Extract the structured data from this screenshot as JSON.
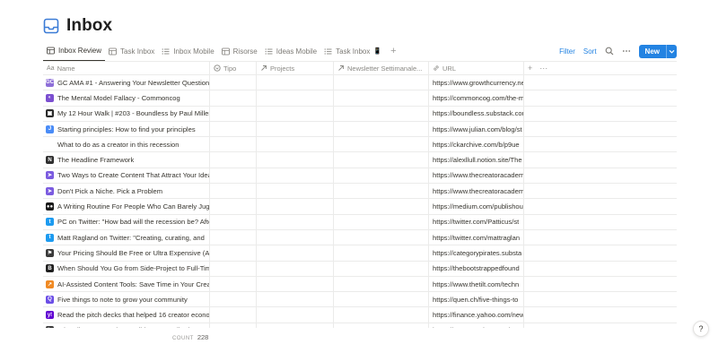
{
  "page": {
    "title": "Inbox",
    "icon": "inbox-icon"
  },
  "views": [
    {
      "label": "Inbox Review",
      "icon": "table-icon",
      "active": true
    },
    {
      "label": "Task Inbox",
      "icon": "table-icon"
    },
    {
      "label": "Inbox Mobile",
      "icon": "list-icon"
    },
    {
      "label": "Risorse",
      "icon": "table-icon"
    },
    {
      "label": "Ideas Mobile",
      "icon": "list-icon"
    },
    {
      "label": "Task Inbox",
      "icon": "list-icon",
      "suffix": "📱"
    }
  ],
  "toolbar": {
    "filter": "Filter",
    "sort": "Sort",
    "new": "New"
  },
  "columns": {
    "name": "Name",
    "tipo": "Tipo",
    "projects": "Projects",
    "newsletter": "Newsletter Settimanale...",
    "url": "URL"
  },
  "rows": [
    {
      "name": "GC AMA #1 - Answering Your Newsletter Questions",
      "url": "https://www.growthcurrency.net",
      "icon": "gc-icon",
      "color": "#8e6fd8",
      "glyph": "GC"
    },
    {
      "name": "The Mental Model Fallacy - Commoncog",
      "url": "https://commoncog.com/the-mental",
      "icon": "commoncog-icon",
      "color": "#7b4fd0",
      "glyph": "◐"
    },
    {
      "name": "My 12 Hour Walk | #203 - Boundless by Paul Millerd",
      "url": "https://boundless.substack.com",
      "icon": "boundless-icon",
      "color": "#2b2b2b",
      "glyph": "▣"
    },
    {
      "name": "Starting principles: How to find your principles",
      "url": "https://www.julian.com/blog/st",
      "icon": "julian-icon",
      "color": "#4a8cf7",
      "glyph": "J"
    },
    {
      "name": "What to do as a creator in this recession",
      "url": "https://ckarchive.com/b/p9ue",
      "icon": "",
      "color": "",
      "glyph": ""
    },
    {
      "name": "The Headline Framework",
      "url": "https://alexllull.notion.site/The",
      "icon": "notion-icon",
      "color": "#2f2f2f",
      "glyph": "N"
    },
    {
      "name": "Two Ways to Create Content That Attract Your Ideal",
      "url": "https://www.thecreatoracademy",
      "icon": "arrow-icon",
      "color": "#7b5be0",
      "glyph": "➤"
    },
    {
      "name": "Don't Pick a Niche. Pick a Problem",
      "url": "https://www.thecreatoracademy",
      "icon": "arrow-icon",
      "color": "#7b5be0",
      "glyph": "➤"
    },
    {
      "name": "A Writing Routine For People Who Can Barely Juggle",
      "url": "https://medium.com/publishous",
      "icon": "medium-icon",
      "color": "#1a1a1a",
      "glyph": "●●"
    },
    {
      "name": "PC on Twitter: \"How bad will the recession be? After",
      "url": "https://twitter.com/Patticus/st",
      "icon": "twitter-icon",
      "color": "#1d9bf0",
      "glyph": "t"
    },
    {
      "name": "Matt Ragland on Twitter: \"Creating, curating, and",
      "url": "https://twitter.com/mattraglan",
      "icon": "twitter-icon",
      "color": "#1d9bf0",
      "glyph": "t"
    },
    {
      "name": "Your Pricing Should Be Free or Ultra Expensive (Ask",
      "url": "https://categorypirates.substa",
      "icon": "flag-icon",
      "color": "#3a3a3a",
      "glyph": "⚑"
    },
    {
      "name": "When Should You Go from Side-Project to Full-Time",
      "url": "https://thebootstrappedfound",
      "icon": "bootstrapped-icon",
      "color": "#1f1f1f",
      "glyph": "B"
    },
    {
      "name": "AI-Assisted Content Tools: Save Time in Your Creative",
      "url": "https://www.thetilt.com/techn",
      "icon": "tilt-icon",
      "color": "#f08a24",
      "glyph": "↗"
    },
    {
      "name": "Five things to note to grow your community",
      "url": "https://quen.ch/five-things-to",
      "icon": "quench-icon",
      "color": "#6b4ee6",
      "glyph": "Q"
    },
    {
      "name": "Read the pitch decks that helped 16 creator economy",
      "url": "https://finance.yahoo.com/new",
      "icon": "yahoo-icon",
      "color": "#6001d2",
      "glyph": "y!"
    },
    {
      "name": "Why All Category Kings Build Fast Small Wins",
      "url": "https://categorypirates.substa",
      "icon": "flag-icon",
      "color": "#3a3a3a",
      "glyph": "⚑"
    }
  ],
  "footer": {
    "count_label": "COUNT",
    "count_value": "228"
  },
  "help": "?"
}
